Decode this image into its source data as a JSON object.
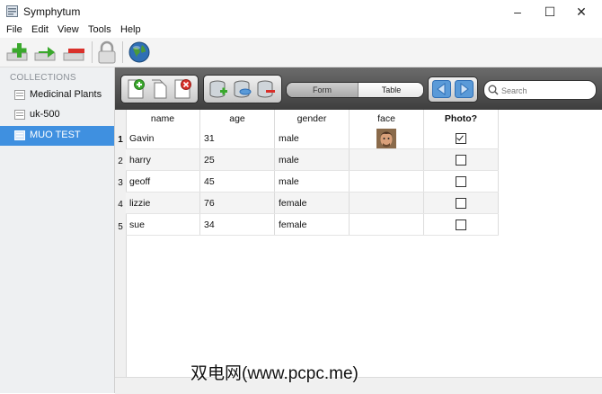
{
  "window": {
    "title": "Symphytum",
    "minimize": "–",
    "maximize": "☐",
    "close": "✕"
  },
  "menu": [
    "File",
    "Edit",
    "View",
    "Tools",
    "Help"
  ],
  "sidebar": {
    "heading": "COLLECTIONS",
    "items": [
      {
        "label": "Medicinal Plants",
        "selected": false
      },
      {
        "label": "uk-500",
        "selected": false
      },
      {
        "label": "MUO TEST",
        "selected": true
      }
    ]
  },
  "view_toggle": {
    "form": "Form",
    "table": "Table",
    "active": "Table"
  },
  "search": {
    "placeholder": "Search"
  },
  "table": {
    "columns": [
      "name",
      "age",
      "gender",
      "face",
      "Photo?"
    ],
    "rows": [
      {
        "num": "1",
        "name": "Gavin",
        "age": "31",
        "gender": "male",
        "has_face": true,
        "photo": true
      },
      {
        "num": "2",
        "name": "harry",
        "age": "25",
        "gender": "male",
        "has_face": false,
        "photo": false
      },
      {
        "num": "3",
        "name": "geoff",
        "age": "45",
        "gender": "male",
        "has_face": false,
        "photo": false
      },
      {
        "num": "4",
        "name": "lizzie",
        "age": "76",
        "gender": "female",
        "has_face": false,
        "photo": false
      },
      {
        "num": "5",
        "name": "sue",
        "age": "34",
        "gender": "female",
        "has_face": false,
        "photo": false
      }
    ]
  },
  "watermark": "双电网(www.pcpc.me)",
  "colors": {
    "accent": "#3f90e0",
    "toolbar_dark": "#4a4a4a"
  }
}
